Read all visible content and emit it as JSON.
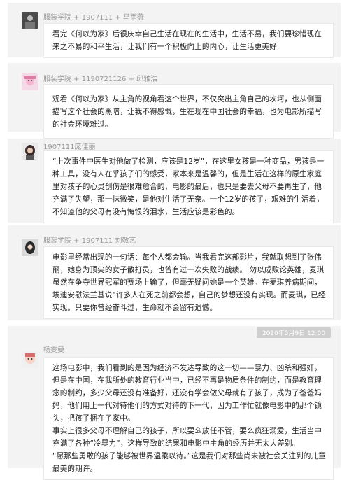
{
  "comments": [
    {
      "user": "服装学院 + 1907111 + 马雨薇",
      "text": "看完《何以为家》后很庆幸自己生活在现在的生活中，生活不易，我们要珍惜现在来之不易的和平生活，让我们有一个积极向上的内心，让生活更美好"
    },
    {
      "user": "服装学院 + 1190721126 + 邱雅浩",
      "text": "观看《何以为家》从主角的视角看这个世界，不仅突出主角自己的坎坷，也从侧面描写这个社会的黑暗，让我不得感慨，生在现在中国社会的幸福，也为电影所描写的社会环境难过。"
    },
    {
      "user": "1907111庞佳丽",
      "text": "“上次事件中医生对他做了检测，应该是12岁”，在这里女孩是一种商品，男孩是一种工具，没有人在乎孩子们的感受，家本来是温馨的，但是生活在这样的原生家庭里对孩子的心灵创伤是很难愈合的，电影的最后，也只是要去父母不要再生了，他充满了失望，那一抹微笑，是他对生活了无奈。一个12岁的孩子，艰难的生活着，不知道他的父母有没有悔恨的泪水，生活应该是彩色的。"
    },
    {
      "user": "服装学院 + 1907111 刘敬艺",
      "text": "电影里经常出现的一句话：每个人都会输。当我看完这部影片，我就联想到了张伟丽，她身为顶尖的女子散打员，也曾有过一次失败的战绩。 勿以成败论英雄，麦琪虽然在争夺世界冠军的赛场上输了，但毫无疑问她是一个英雄。在麦琪养病期间，埃迪安慰法兰基说“许多人在死之前都会想，自己的梦想还没有实现。而麦琪，已经实现。只要你曾经奋斗过，生命就不会留有遗憾。"
    },
    {
      "user": "杨雯曼",
      "date": "2020年5月9日 12:00",
      "text1": "这场电影中，我们看到的是因为经济不发达导致的这一切——暴力、凶杀和强奸，但是在中国，在我所处的教育行业当中，已经不再是物质条件的制约，而是教育理念的制约，多少父母还没有准备好，还没有学会做父母就有了孩子，成为了爸爸妈妈，他们用上一代对待他们的方式对待的下一代，因为工作忙就像电影中的那个镜头，把孩子捆在了家中。",
      "text2": "事实上很多父母不理解自己的孩子，所以要么放任不管，要么疯狂溺爱，生活当中充满了各种“冷暴力”，这样导致的结果和电影中主角的经历并无太大差别。",
      "text3": "“愿那些勇敢的孩子能够被世界温柔以待。”这是我们对那些尚未被社会关注到的儿童最美的期许。"
    }
  ]
}
